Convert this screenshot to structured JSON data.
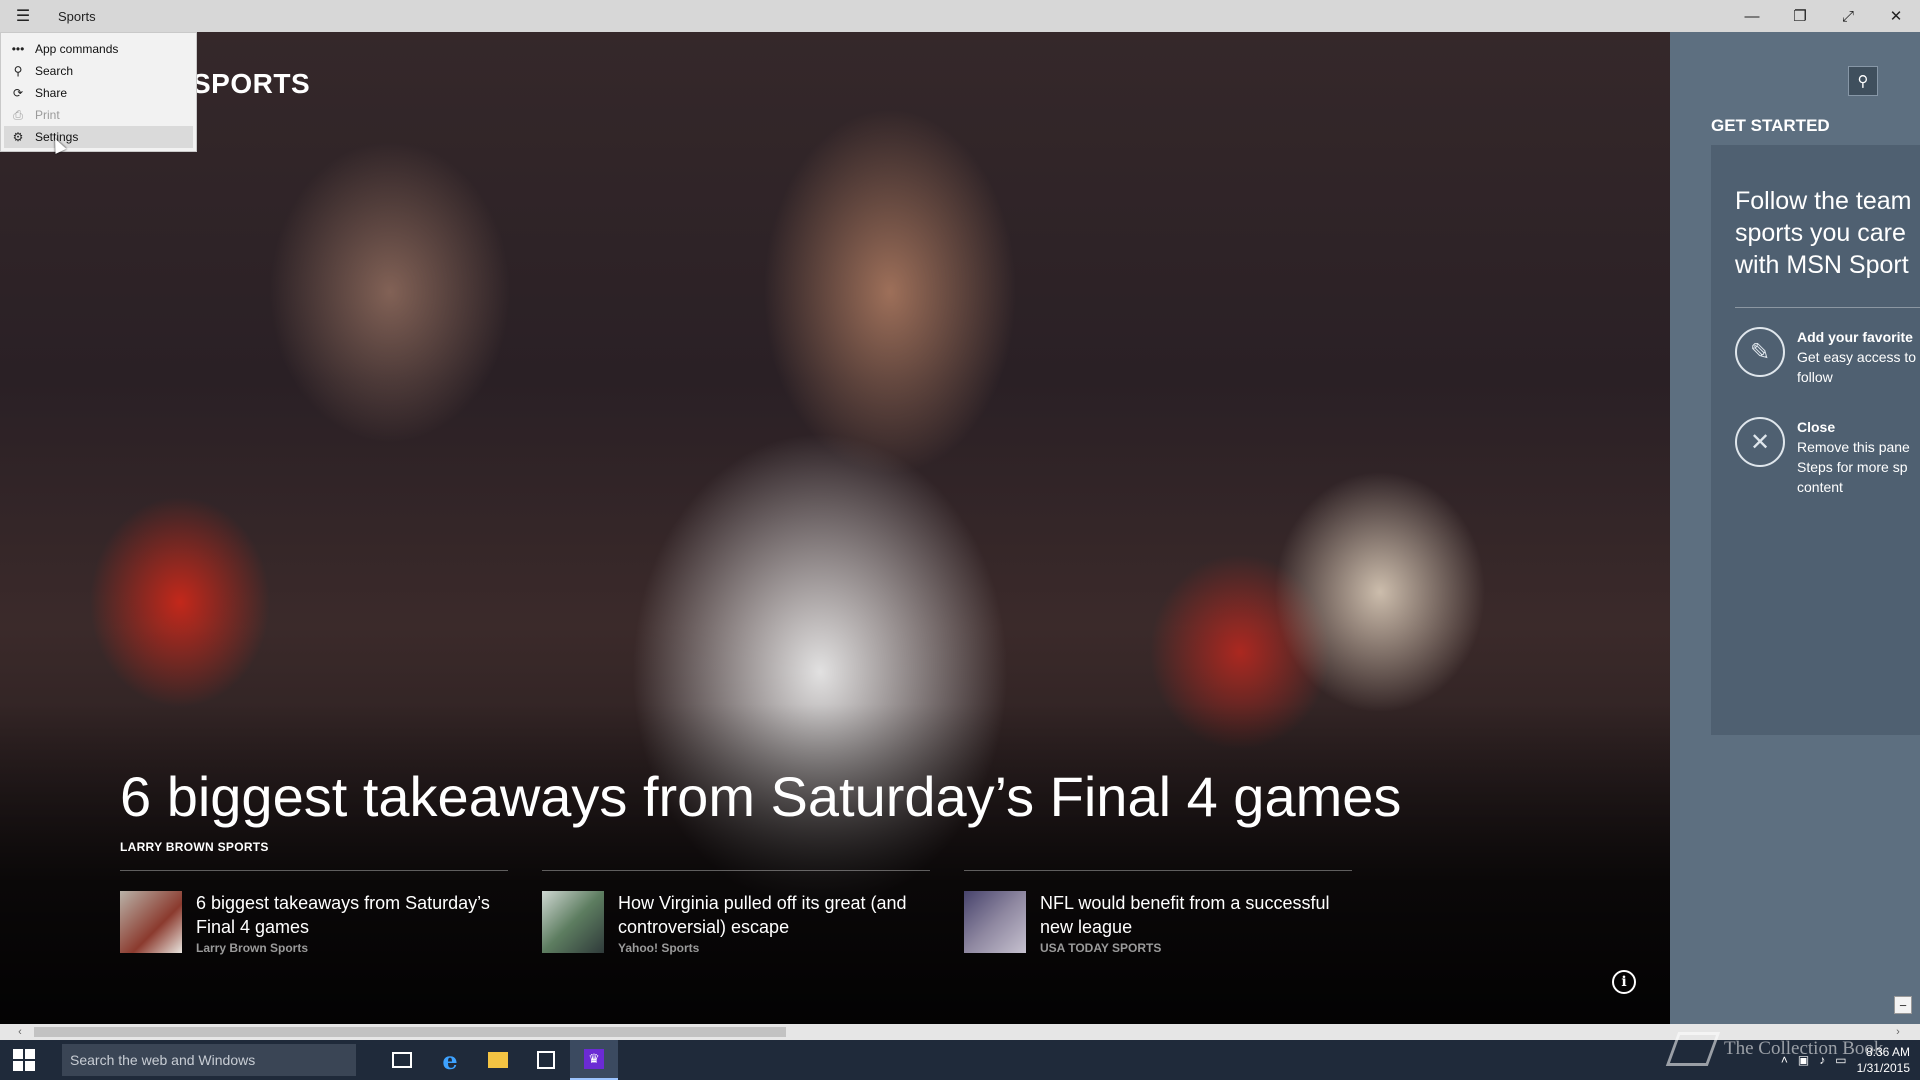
{
  "window": {
    "title": "Sports",
    "menu_icon": "hamburger-icon",
    "controls": {
      "minimize": "—",
      "restore": "❐",
      "fullscreen": "⤢",
      "close": "✕"
    }
  },
  "command_menu": {
    "items": [
      {
        "label": "App commands",
        "icon": "more-icon",
        "glyph": "•••",
        "disabled": false
      },
      {
        "label": "Search",
        "icon": "search-icon",
        "glyph": "⚲",
        "disabled": false
      },
      {
        "label": "Share",
        "icon": "share-icon",
        "glyph": "⟳",
        "disabled": false
      },
      {
        "label": "Print",
        "icon": "print-icon",
        "glyph": "⎙",
        "disabled": true
      },
      {
        "label": "Settings",
        "icon": "gear-icon",
        "glyph": "⚙",
        "disabled": false,
        "hovered": true
      }
    ]
  },
  "hero": {
    "brand": "SPORTS",
    "headline": "6 biggest takeaways from Saturday’s Final 4 games",
    "source": "LARRY BROWN SPORTS",
    "info_glyph": "i"
  },
  "stories": [
    {
      "title": "6 biggest takeaways from Saturday’s Final 4 games",
      "source": "Larry Brown Sports"
    },
    {
      "title": "How Virginia pulled off its great (and controversial) escape",
      "source": "Yahoo! Sports"
    },
    {
      "title": "NFL would benefit from a successful new league",
      "source": "USA TODAY SPORTS"
    }
  ],
  "right_panel": {
    "search_glyph": "⚲",
    "title": "GET STARTED",
    "heading_lines": [
      "Follow the team",
      "sports you care",
      "with MSN Sport"
    ],
    "items": [
      {
        "title": "Add your favorite",
        "desc_lines": [
          "Get easy access to",
          "follow"
        ],
        "icon": "pencil-icon",
        "glyph": "✎"
      },
      {
        "title": "Close",
        "desc_lines": [
          "Remove this pane",
          "Steps for more sp",
          "content"
        ],
        "icon": "close-circle-icon",
        "glyph": "✕"
      }
    ]
  },
  "scrollbar": {
    "left_arrow": "‹",
    "right_arrow": "›",
    "collapse_glyph": "−",
    "position_fraction": 0.0
  },
  "taskbar": {
    "search_placeholder": "Search the web and Windows",
    "clock_time": "8:36 AM",
    "clock_date": "1/31/2015",
    "watermark": "The Collection Book"
  }
}
